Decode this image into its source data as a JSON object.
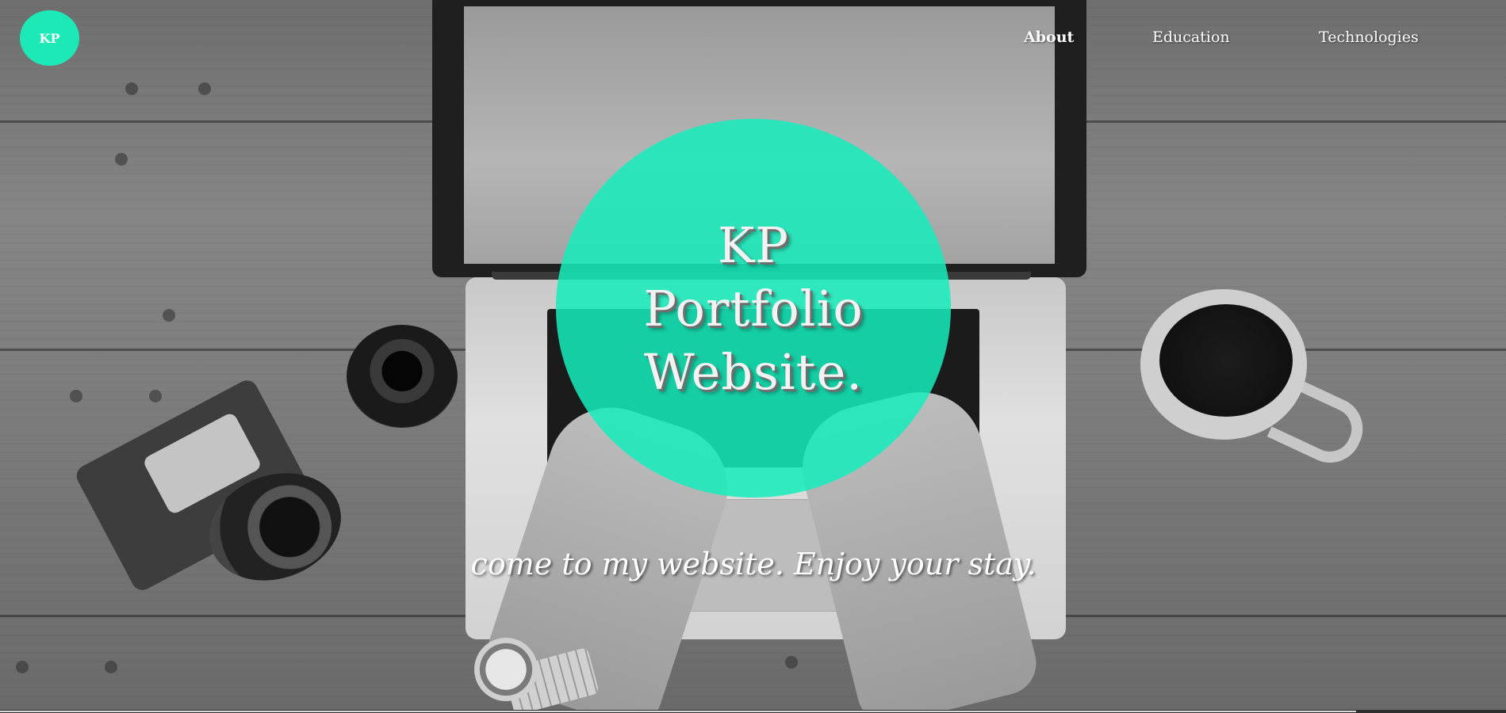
{
  "header": {
    "logo_text": "KP",
    "nav": [
      {
        "label": "About",
        "active": true
      },
      {
        "label": "Education",
        "active": false
      },
      {
        "label": "Technologies",
        "active": false
      }
    ]
  },
  "hero": {
    "title_lines": [
      "KP",
      "Portfolio",
      "Website."
    ],
    "tagline": "come to my website. Enjoy your stay.",
    "circle_color": "#1de9b6"
  }
}
